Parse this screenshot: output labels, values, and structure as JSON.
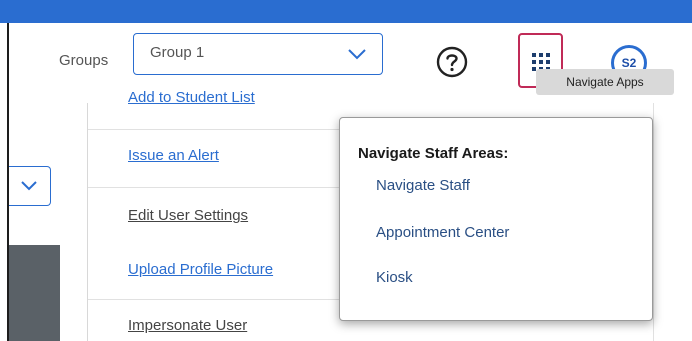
{
  "header": {
    "groups_label": "Groups",
    "groups_select_value": "Group 1",
    "apps_tooltip": "Navigate Apps",
    "avatar_initials": "S2"
  },
  "menu": {
    "clipped_item": "Add to Student List",
    "items": [
      {
        "label": "Issue an Alert"
      },
      {
        "label": "Edit User Settings"
      },
      {
        "label": "Upload Profile Picture"
      },
      {
        "label": "Impersonate User"
      }
    ]
  },
  "dropdown": {
    "title": "Navigate Staff Areas:",
    "items": [
      {
        "label": "Navigate Staff"
      },
      {
        "label": "Appointment Center"
      },
      {
        "label": "Kiosk"
      }
    ]
  },
  "colors": {
    "accent": "#2a6dd0",
    "focus_border": "#c02a57"
  },
  "icons": {
    "help": "question-circle-icon",
    "apps": "grid-icon",
    "dropdown": "chevron-down-icon"
  }
}
